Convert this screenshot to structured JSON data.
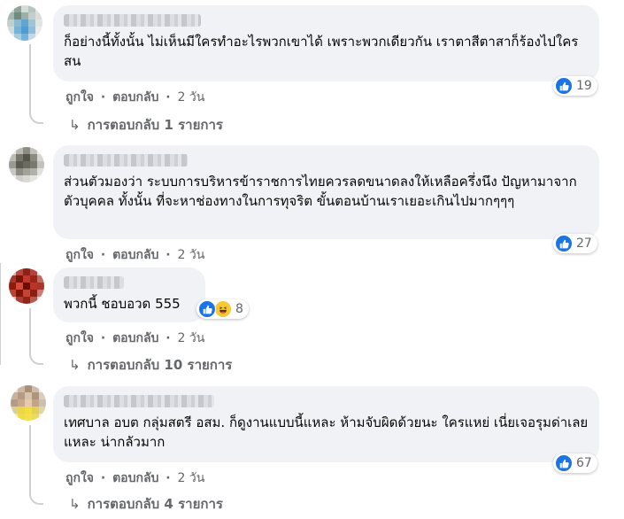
{
  "comments": [
    {
      "text": "ก็อย่างนี้ทั้งนั้น ไม่เห็นมีใครทำอะไรพวกเขาได้ เพราะพวกเดียวกัน เราตาสีตาสาก็ร้องไปใครสน",
      "like": "ถูกใจ",
      "reply": "ตอบกลับ",
      "time": "2 วัน",
      "reaction_count": "19",
      "replies_label": "การตอบกลับ 1 รายการ"
    },
    {
      "text": "ส่วนตัวมองว่า ระบบการบริหารข้าราชการไทยควรลดขนาดลงให้เหลือครึ่งนึง ปัญหามาจากตัวบุคคล ทั้งนั้น ที่จะหาช่องทางในการทุจริต ขั้นตอนบ้านเราเยอะเกินไปมากๆๆๆ",
      "like": "ถูกใจ",
      "reply": "ตอบกลับ",
      "time": "2 วัน",
      "reaction_count": "27"
    },
    {
      "text": "พวกนี้ ชอบอวด 555",
      "like": "ถูกใจ",
      "reply": "ตอบกลับ",
      "time": "2 วัน",
      "reaction_count": "8",
      "replies_label": "การตอบกลับ 10 รายการ"
    },
    {
      "text": "เทศบาล อบต กลุ่มสตรี อสม. ก็ดูงานแบบนี้แหละ ห้ามจับผิดด้วยนะ ใครแหย่ เนี่ยเจอรุมด่าเลยแหละ น่ากลัวมาก",
      "like": "ถูกใจ",
      "reply": "ตอบกลับ",
      "time": "2 วัน",
      "reaction_count": "67",
      "replies_label": "การตอบกลับ 4 รายการ"
    }
  ],
  "separator": "·",
  "reply_arrow": "↳",
  "colors": {
    "like_blue": "#1b74e4",
    "haha_yellow": "#f7c836",
    "bubble": "#f0f2f5",
    "meta": "#65676b"
  }
}
